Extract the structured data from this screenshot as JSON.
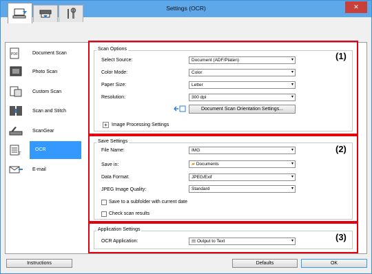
{
  "window": {
    "title": "Settings (OCR)",
    "close_label": "✕"
  },
  "tabs": [
    {
      "name": "scan-from-computer",
      "icon": "computer-scan-icon"
    },
    {
      "name": "scan-from-panel",
      "icon": "scanner-icon"
    },
    {
      "name": "general-settings",
      "icon": "tools-icon"
    }
  ],
  "sidebar": {
    "items": [
      {
        "label": "Document Scan",
        "icon": "document-scan-icon"
      },
      {
        "label": "Photo Scan",
        "icon": "photo-scan-icon"
      },
      {
        "label": "Custom Scan",
        "icon": "custom-scan-icon"
      },
      {
        "label": "Scan and Stitch",
        "icon": "scan-stitch-icon"
      },
      {
        "label": "ScanGear",
        "icon": "scangear-icon"
      },
      {
        "label": "OCR",
        "icon": "ocr-icon",
        "selected": true
      },
      {
        "label": "E-mail",
        "icon": "email-icon"
      }
    ]
  },
  "scan_options": {
    "title": "Scan Options",
    "select_source_label": "Select Source:",
    "select_source_value": "Document (ADF/Platen)",
    "color_mode_label": "Color Mode:",
    "color_mode_value": "Color",
    "paper_size_label": "Paper Size:",
    "paper_size_value": "Letter",
    "resolution_label": "Resolution:",
    "resolution_value": "300 dpi",
    "orientation_button": "Document Scan Orientation Settings...",
    "image_processing_label": "Image Processing Settings",
    "plus": "+"
  },
  "save_settings": {
    "title": "Save Settings",
    "file_name_label": "File Name:",
    "file_name_value": "IMG",
    "save_in_label": "Save in:",
    "save_in_value": "Documents",
    "data_format_label": "Data Format:",
    "data_format_value": "JPEG/Exif",
    "jpeg_quality_label": "JPEG Image Quality:",
    "jpeg_quality_value": "Standard",
    "subfolder_label": "Save to a subfolder with current date",
    "check_results_label": "Check scan results"
  },
  "app_settings": {
    "title": "Application Settings",
    "ocr_app_label": "OCR Application:",
    "ocr_app_value": "Output to Text"
  },
  "callouts": [
    "(1)",
    "(2)",
    "(3)"
  ],
  "footer": {
    "instructions": "Instructions",
    "defaults": "Defaults",
    "ok": "OK"
  },
  "arrow": "▾",
  "colors": {
    "callout_red": "#e4000f",
    "selection_blue": "#3399ff",
    "titlebar": "#5ea7e8"
  }
}
